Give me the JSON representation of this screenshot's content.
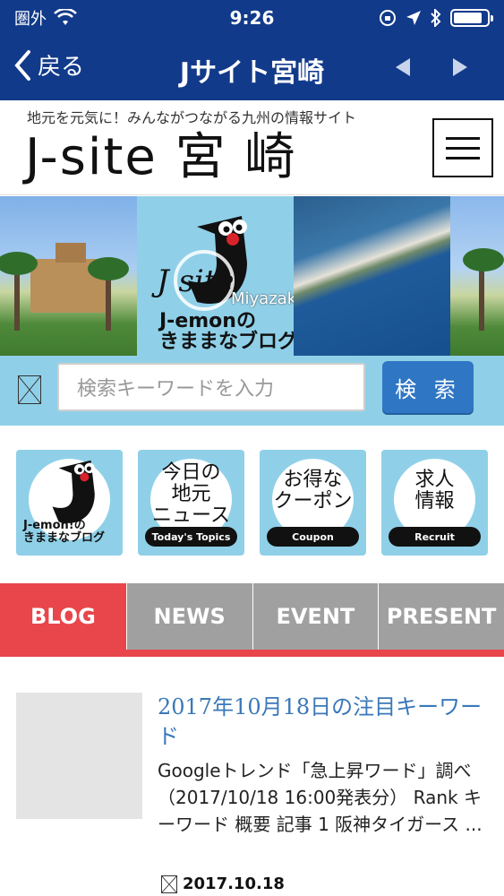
{
  "status_bar": {
    "carrier": "圏外",
    "time": "9:26"
  },
  "nav": {
    "back_label": "戻る",
    "title": "Jサイト宮崎"
  },
  "site": {
    "tagline": "地元を元気に！みんながつながる九州の情報サイト",
    "logo": "J-site 宮 崎"
  },
  "banner": {
    "logo_jsite": "J site",
    "logo_miyazaki": "Miyazaki",
    "logo_blog_line1": "J-emonの",
    "logo_blog_line2": "きままなブログ"
  },
  "search": {
    "placeholder": "検索キーワードを入力",
    "button_label": "検 索"
  },
  "tiles": [
    {
      "label_line1": "J-emon!の",
      "label_line2": "きままなブログ",
      "tag": ""
    },
    {
      "label_line1": "今日の",
      "label_line2": "地元",
      "label_line3": "ニュース",
      "tag": "Today's Topics"
    },
    {
      "label_line1": "お得な",
      "label_line2": "クーポン",
      "tag": "Coupon"
    },
    {
      "label_line1": "求人",
      "label_line2": "情報",
      "tag": "Recruit"
    }
  ],
  "tabs": [
    {
      "label": "BLOG",
      "active": true
    },
    {
      "label": "NEWS",
      "active": false
    },
    {
      "label": "EVENT",
      "active": false
    },
    {
      "label": "PRESENT",
      "active": false
    }
  ],
  "article": {
    "title": "2017年10月18日の注目キーワード",
    "body": "Googleトレンド「急上昇ワード」調べ　（2017/10/18 16:00発表分） Rank キーワード 概要 記事 1 阪神タイガース ...",
    "date": "2017.10.18"
  },
  "colors": {
    "nav_blue": "#123a8a",
    "accent_red": "#e8464b",
    "light_blue": "#8fd0e8",
    "button_blue": "#2f76c4",
    "link_blue": "#3a78b8"
  }
}
